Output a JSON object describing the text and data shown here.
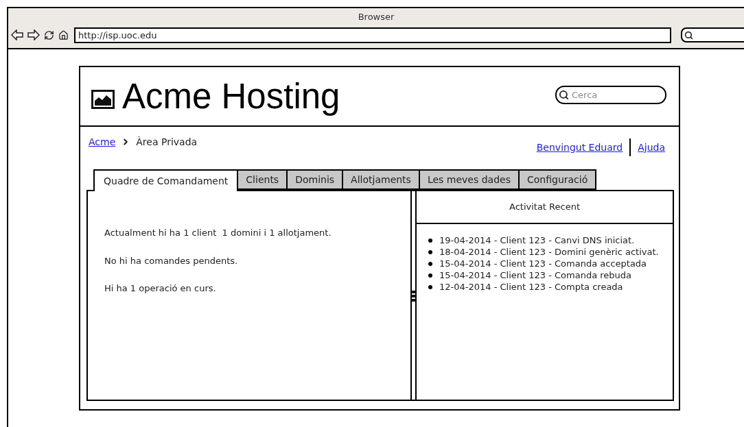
{
  "window": {
    "title": "Browser"
  },
  "address_bar": {
    "value": "http://isp.uoc.edu"
  },
  "site": {
    "title": "Acme Hosting",
    "search": {
      "placeholder": "Cerca"
    },
    "breadcrumb": [
      {
        "label": "Acme",
        "kind": "link"
      },
      {
        "label": "Àrea Privada",
        "kind": "current"
      }
    ],
    "user_links": [
      "Benvingut Eduard",
      "Ajuda"
    ],
    "tabs": [
      {
        "label": "Quadre de Comandament",
        "selected": true
      },
      {
        "label": "Clients",
        "selected": false
      },
      {
        "label": "Dominis",
        "selected": false
      },
      {
        "label": "Allotjaments",
        "selected": false
      },
      {
        "label": "Les meves dades",
        "selected": false
      },
      {
        "label": "Configuració",
        "selected": false
      }
    ],
    "summary": [
      "Actualment hi ha 1 client  1 domini i 1 allotjament.",
      "No hi ha comandes pendents.",
      "Hi ha 1 operació en curs."
    ],
    "activity": {
      "title": "Activitat Recent",
      "items": [
        "19-04-2014 - Client 123 - Canvi DNS iniciat.",
        "18-04-2014 - Client 123 - Domini genèric activat.",
        "15-04-2014 - Client 123 - Comanda acceptada",
        "15-04-2014 - Client 123 - Comanda rebuda",
        "12-04-2014 - Client 123 - Compta creada"
      ]
    }
  }
}
